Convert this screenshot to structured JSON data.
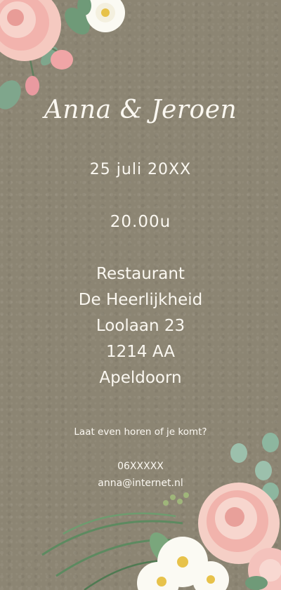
{
  "invitation": {
    "names": "Anna & Jeroen",
    "date": "25 juli 20XX",
    "time": "20.00u",
    "venue_line1": "Restaurant",
    "venue_line2": "De Heerlijkheid",
    "street": "Loolaan 23",
    "postcode": "1214 AA",
    "city": "Apeldoorn",
    "rsvp_text": "Laat even horen of je komt?",
    "phone": "06XXXXX",
    "email": "anna@internet.nl"
  },
  "decoration": {
    "top_left": "rose-bouquet-icon",
    "bottom_right": "rose-bouquet-icon",
    "accent_colors": {
      "background": "#8c8573",
      "text": "#fbf8f1",
      "rose": "#f2b8b4",
      "leaf": "#6f9a78"
    }
  }
}
